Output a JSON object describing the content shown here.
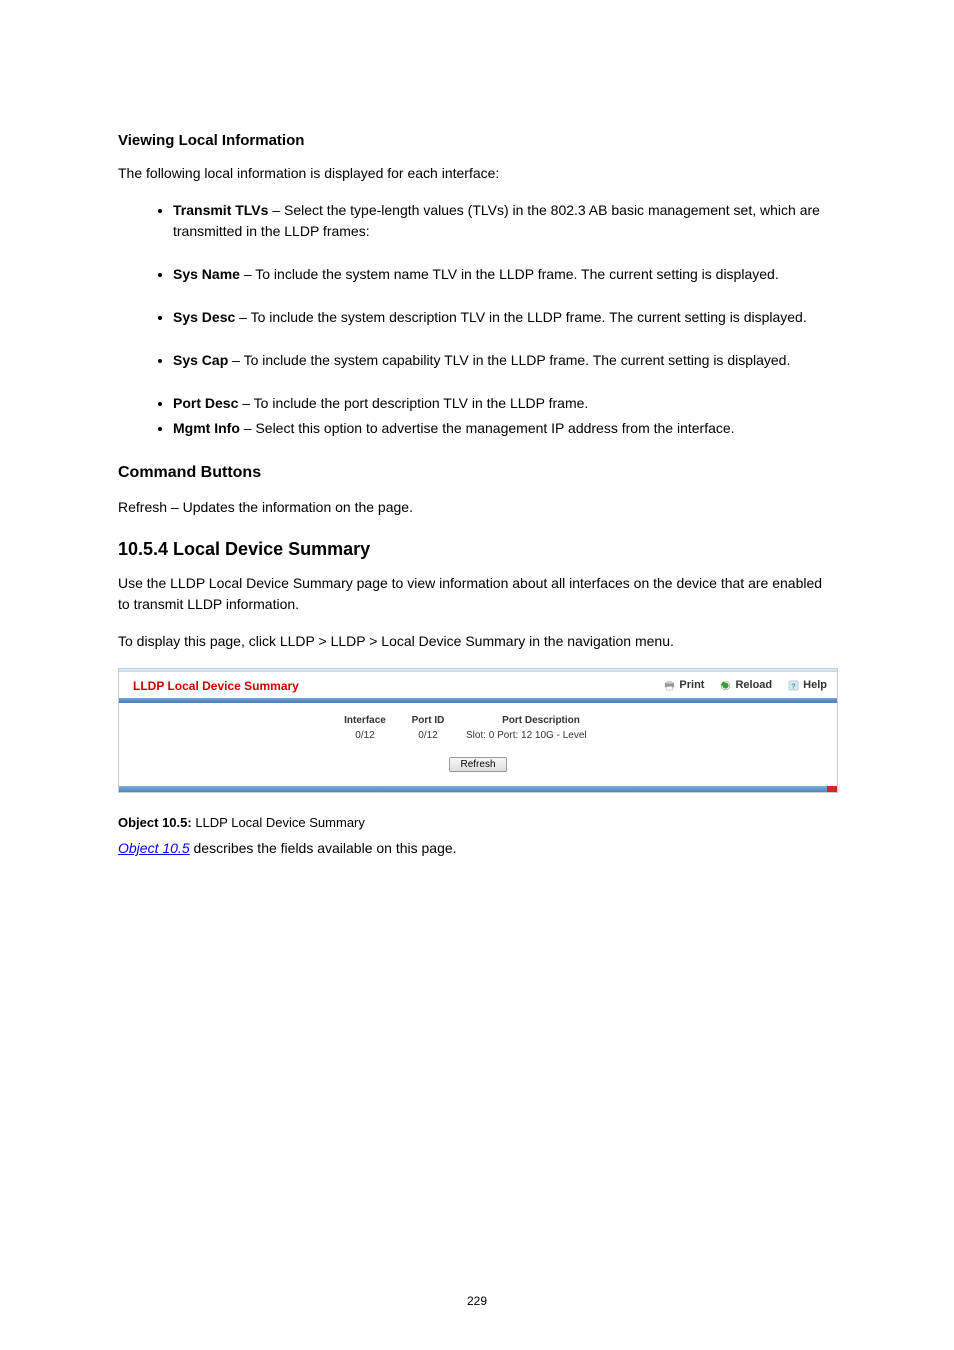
{
  "doc": {
    "viewing": {
      "heading": "Viewing Local Information",
      "intro": "The following local information is displayed for each interface:",
      "bullets": [
        {
          "term": "Transmit TLVs",
          "desc": " – Select the type-length values (TLVs) in the 802.3 AB basic management set, which are transmitted in the LLDP frames:"
        },
        {
          "term": "Sys Name",
          "desc": " – To include the system name TLV in the LLDP frame. The current setting is displayed."
        },
        {
          "term": "Sys Desc",
          "desc": " – To include the system description TLV in the LLDP frame. The current setting is displayed."
        },
        {
          "term": "Sys Cap",
          "desc": " – To include the system capability TLV in the LLDP frame. The current setting is displayed."
        },
        {
          "term": "Port Desc",
          "desc": " – To include the port description TLV in the LLDP frame."
        },
        {
          "term": "Mgmt Info",
          "desc": " – Select this option to advertise the management IP address from the interface."
        }
      ],
      "cmds": {
        "heading": "Command Buttons",
        "text": "Refresh – Updates the information on the page."
      }
    },
    "section": {
      "number": "10.5.4 Local Device Summary",
      "intro": "Use the LLDP Local Device Summary page to view information about all interfaces on the device that are enabled to transmit LLDP information.",
      "nav": "To display this page, click LLDP > LLDP > Local Device Summary in the navigation menu."
    },
    "figure": {
      "title": "LLDP Local Device Summary",
      "actions": {
        "print": "Print",
        "reload": "Reload",
        "help": "Help"
      },
      "table": {
        "headers": {
          "interface": "Interface",
          "portid": "Port ID",
          "desc": "Port Description"
        },
        "row": {
          "interface": "0/12",
          "portid": "0/12",
          "desc": "Slot: 0 Port: 12 10G - Level"
        }
      },
      "refresh": "Refresh"
    },
    "caption_label": "Object 10.5:",
    "caption_text": "LLDP Local Device Summary",
    "details_link": "Object 10.5",
    "details_text": " describes the fields available on this page.",
    "footer": "229"
  }
}
